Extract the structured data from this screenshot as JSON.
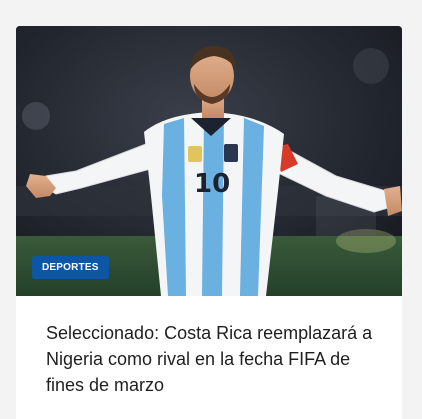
{
  "article": {
    "category": "DEPORTES",
    "headline": "Seleccionado: Costa Rica reemplazará a Nigeria como rival en la fecha FIFA de fines de marzo",
    "player_number": "10",
    "image_subject": "soccer player in white and sky-blue striped jersey celebrating with arms spread"
  },
  "colors": {
    "badge": "#0d56a6",
    "jersey_blue": "#6ab0e0",
    "captain_band": "#d83a2a"
  }
}
